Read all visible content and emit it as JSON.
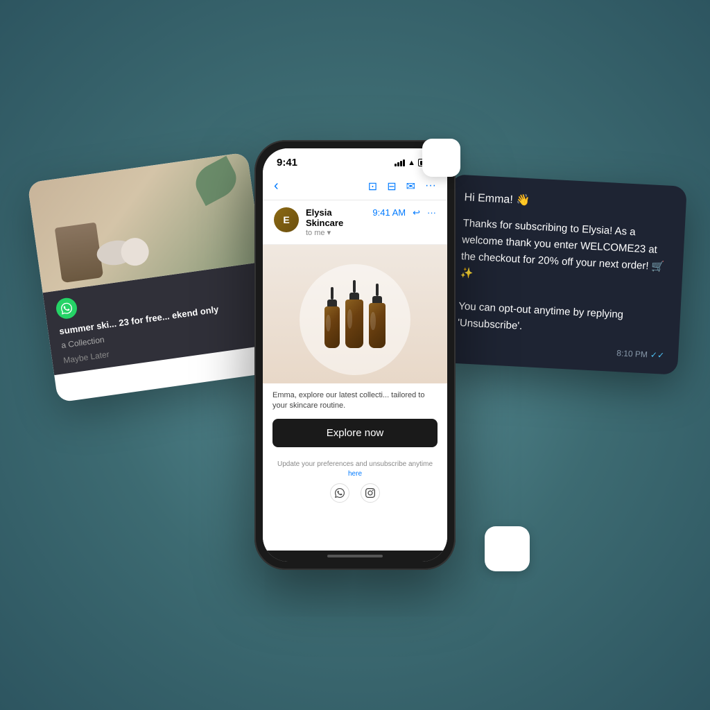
{
  "phone": {
    "status_bar": {
      "time": "9:41",
      "signal": "signal",
      "wifi": "wifi",
      "battery": "battery"
    },
    "email": {
      "sender_name": "Elysia Skincare",
      "sender_time": "9:41 AM",
      "sender_to": "to me",
      "back_label": "‹",
      "toolbar_icons": [
        "⊡",
        "⊟",
        "✉",
        "···"
      ],
      "reply_icon": "↩",
      "more_icon": "···",
      "body_text": "Emma, explore our latest collecti... tailored to your skincare routine.",
      "cta_button": "Explore now",
      "footer_text": "Update your preferences and unsubscribe anytime",
      "footer_link": "here",
      "social_wa": "⊚",
      "social_ig": "◻"
    }
  },
  "whatsapp_card": {
    "promo_text": "summer ski... 23 for free... ekend only",
    "collection_label": "a Collection",
    "maybe_later": "Maybe Later"
  },
  "chat_card": {
    "greeting": "Hi Emma! 👋",
    "line1": "Thanks for subscribing to Elysia! As a welcome thank you enter WELCOME23 at the checkout for 20% off your next order! 🛒✨",
    "line2": "You can opt-out anytime by replying 'Unsubscribe'.",
    "time": "8:10 PM",
    "check_marks": "✓✓"
  },
  "colors": {
    "background": "#4d8088",
    "phone_bg": "#1a1a1a",
    "chat_card_bg": "#1e2433",
    "whatsapp_card_bg": "rgba(30,30,40,0.92)",
    "explore_btn": "#1a1a1a",
    "accent_blue": "#007AFF"
  }
}
